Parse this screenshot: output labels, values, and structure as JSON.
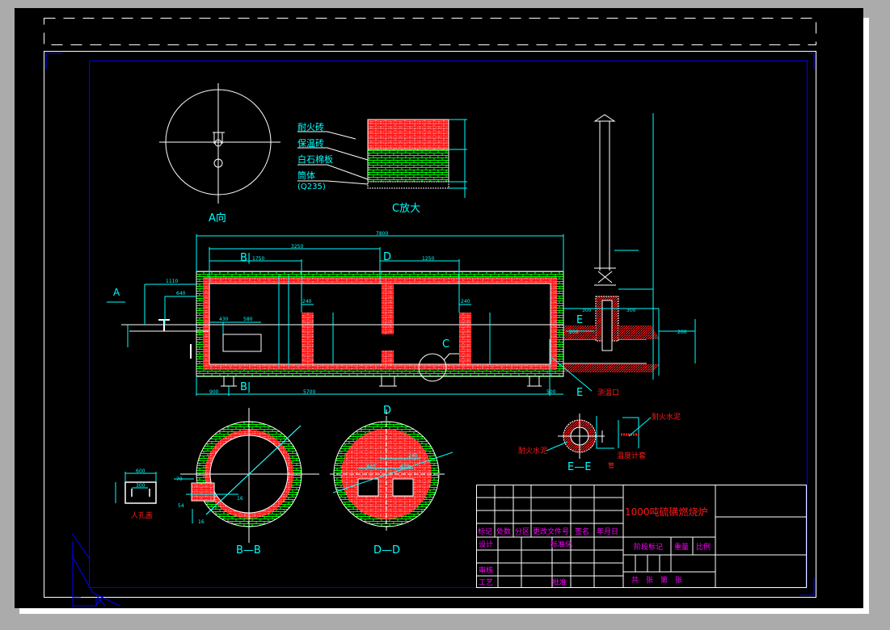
{
  "colors": {
    "background": "#000000",
    "frame": "#ffffff",
    "dimension": "#00ffff",
    "firebrick": "#ff1a1a",
    "insulation": "#00ff00",
    "title_block_text": "#ff00ff",
    "border": "#0000ff",
    "workspace": "#ababab"
  },
  "views": {
    "a_view": {
      "label": "A向"
    },
    "c_detail": {
      "label": "C放大",
      "layers": [
        "耐火砖",
        "保温砖",
        "白石棉板",
        "筒体"
      ],
      "material": "(Q235)"
    },
    "section": {
      "arrow_a": "A",
      "cut_b_top": "B|",
      "cut_b_bottom": "B|",
      "cut_d_top": "D",
      "cut_d_bottom": "D",
      "detail_c": "C",
      "cut_e_top": "E",
      "cut_e_bottom": "E",
      "temp_port": "测温口",
      "dims": {
        "overall": "7800",
        "d1": "3250",
        "d2": "1750",
        "d3": "1250",
        "bottom": "5700",
        "support_left": "900",
        "support_right": "500",
        "nozzle1": "1110",
        "nozzle2": "640",
        "door_w": "430",
        "door_w2": "580",
        "wall1": "240",
        "wall2": "240",
        "duct1": "300",
        "duct2": "300",
        "duct3": "200",
        "duct4": "200"
      }
    },
    "bb": {
      "label": "B—B",
      "dims": [
        "70",
        "16",
        "54",
        "16"
      ]
    },
    "dd": {
      "label": "D—D",
      "dims": [
        "240",
        "420",
        "420"
      ]
    },
    "manhole": {
      "label": "人孔盖",
      "dims": [
        "600",
        "300"
      ]
    },
    "ee": {
      "label": "E—E",
      "note1": "耐火水泥",
      "note2": "耐火水泥",
      "note3": "温度计套",
      "note4": "管"
    }
  },
  "title_block": {
    "drawing_title": "1000吨硫磺燃烧炉",
    "headers": [
      "标记",
      "处数",
      "分区",
      "更改文件号",
      "签名",
      "年月日"
    ],
    "design": "设计",
    "standardization": "标准化",
    "review": "审核",
    "process": "工艺",
    "approve": "批准",
    "stage_mark": "阶段标记",
    "weight": "重量",
    "scale": "比例",
    "sheets": "共　张　第　张"
  }
}
